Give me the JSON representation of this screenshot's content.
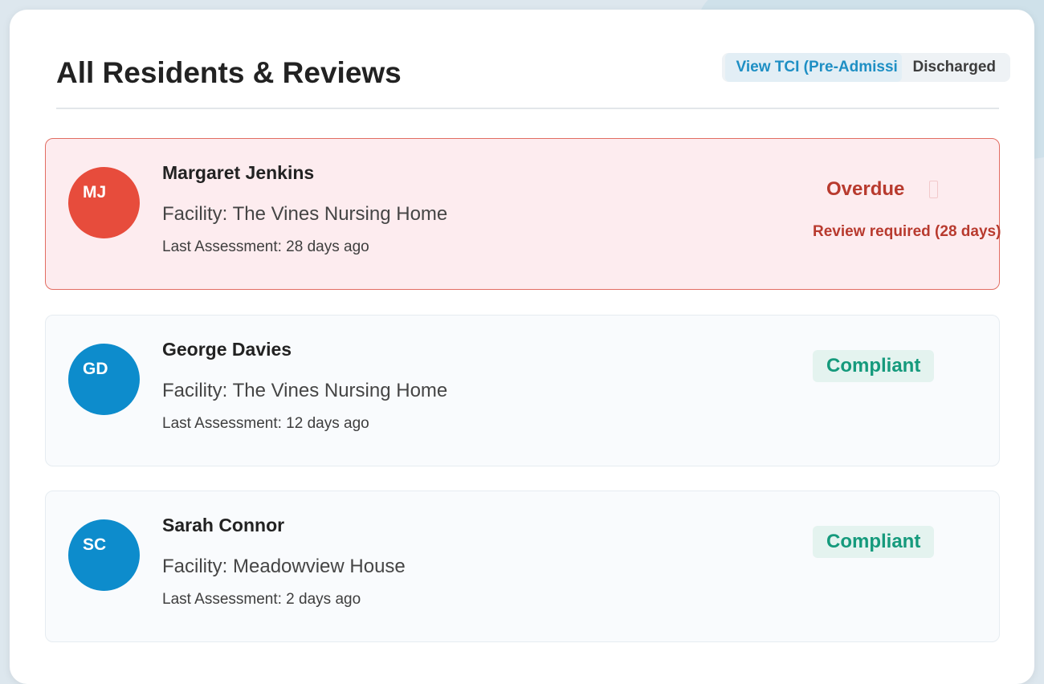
{
  "header": {
    "title": "All Residents & Reviews",
    "toggle": {
      "active_label": "View TCI (Pre-Admissi",
      "other_label": "Discharged"
    }
  },
  "residents": [
    {
      "initials": "MJ",
      "name": "Margaret Jenkins",
      "facility": "Facility: The Vines Nursing Home",
      "last_assessment": "Last Assessment: 28 days ago",
      "status": "Overdue",
      "note": "Review required (28 days)",
      "avatar_color": "#e74c3c"
    },
    {
      "initials": "GD",
      "name": "George Davies",
      "facility": "Facility: The Vines Nursing Home",
      "last_assessment": "Last Assessment: 12 days ago",
      "status": "Compliant",
      "avatar_color": "#0d8ccc"
    },
    {
      "initials": "SC",
      "name": "Sarah Connor",
      "facility": "Facility: Meadowview House",
      "last_assessment": "Last Assessment: 2 days ago",
      "status": "Compliant",
      "avatar_color": "#0d8ccc"
    }
  ],
  "colors": {
    "overdue": "#b83a2e",
    "compliant": "#159a7c",
    "accent": "#1e8fc4"
  }
}
